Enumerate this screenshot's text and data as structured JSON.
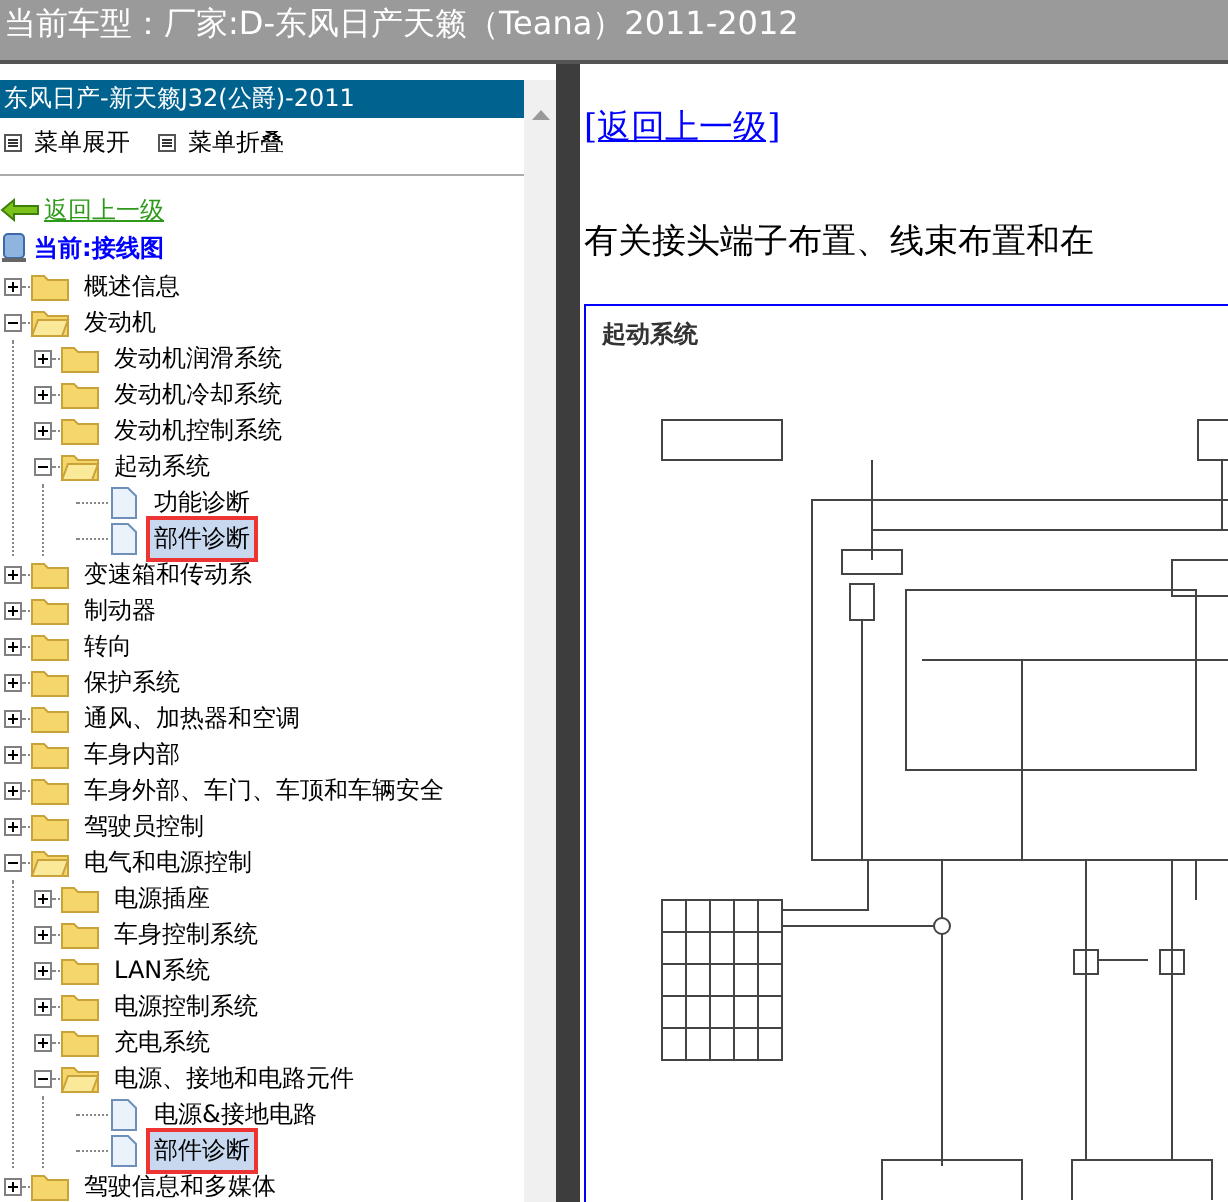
{
  "window": {
    "title": "当前车型：厂家:D-东风日产天籁（Teana）2011-2012"
  },
  "sidebar": {
    "header": "东风日产-新天籁J32(公爵)-2011",
    "menu": [
      "菜单展开",
      "菜单折叠"
    ],
    "back_link": "返回上一级",
    "current": "当前:接线图",
    "tree": [
      {
        "label": "概述信息",
        "kind": "folder",
        "expanded": false,
        "selected": false
      },
      {
        "label": "发动机",
        "kind": "folder",
        "expanded": true,
        "selected": false,
        "children": [
          {
            "label": "发动机润滑系统",
            "kind": "folder",
            "expanded": false,
            "selected": false
          },
          {
            "label": "发动机冷却系统",
            "kind": "folder",
            "expanded": false,
            "selected": false
          },
          {
            "label": "发动机控制系统",
            "kind": "folder",
            "expanded": false,
            "selected": false
          },
          {
            "label": "起动系统",
            "kind": "folder",
            "expanded": true,
            "selected": false,
            "children": [
              {
                "label": "功能诊断",
                "kind": "page",
                "selected": false
              },
              {
                "label": "部件诊断",
                "kind": "page",
                "selected": true
              }
            ]
          }
        ]
      },
      {
        "label": "变速箱和传动系",
        "kind": "folder",
        "expanded": false,
        "selected": false
      },
      {
        "label": "制动器",
        "kind": "folder",
        "expanded": false,
        "selected": false
      },
      {
        "label": "转向",
        "kind": "folder",
        "expanded": false,
        "selected": false
      },
      {
        "label": "保护系统",
        "kind": "folder",
        "expanded": false,
        "selected": false
      },
      {
        "label": "通风、加热器和空调",
        "kind": "folder",
        "expanded": false,
        "selected": false
      },
      {
        "label": "车身内部",
        "kind": "folder",
        "expanded": false,
        "selected": false
      },
      {
        "label": "车身外部、车门、车顶和车辆安全",
        "kind": "folder",
        "expanded": false,
        "selected": false
      },
      {
        "label": "驾驶员控制",
        "kind": "folder",
        "expanded": false,
        "selected": false
      },
      {
        "label": "电气和电源控制",
        "kind": "folder",
        "expanded": true,
        "selected": false,
        "children": [
          {
            "label": "电源插座",
            "kind": "folder",
            "expanded": false,
            "selected": false
          },
          {
            "label": "车身控制系统",
            "kind": "folder",
            "expanded": false,
            "selected": false
          },
          {
            "label": "LAN系统",
            "kind": "folder",
            "expanded": false,
            "selected": false
          },
          {
            "label": "电源控制系统",
            "kind": "folder",
            "expanded": false,
            "selected": false
          },
          {
            "label": "充电系统",
            "kind": "folder",
            "expanded": false,
            "selected": false
          },
          {
            "label": "电源、接地和电路元件",
            "kind": "folder",
            "expanded": true,
            "selected": false,
            "children": [
              {
                "label": "电源&接地电路",
                "kind": "page",
                "selected": false
              },
              {
                "label": "部件诊断",
                "kind": "page",
                "selected": true
              }
            ]
          }
        ]
      },
      {
        "label": "驾驶信息和多媒体",
        "kind": "folder",
        "expanded": false,
        "selected": false
      }
    ]
  },
  "content": {
    "back_link": "[返回上一级]",
    "intro": "有关接头端子布置、线束布置和在",
    "diagram": {
      "title": "起动系统"
    }
  }
}
